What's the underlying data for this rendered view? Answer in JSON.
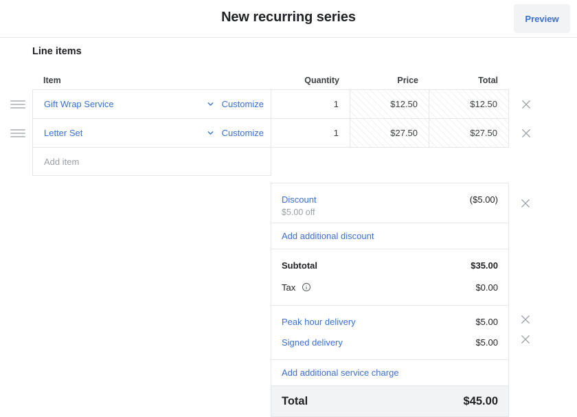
{
  "header": {
    "title": "New recurring series",
    "preview_label": "Preview"
  },
  "line_items": {
    "section_title": "Line items",
    "columns": {
      "item": "Item",
      "quantity": "Quantity",
      "price": "Price",
      "total": "Total"
    },
    "rows": [
      {
        "name": "Gift Wrap Service",
        "customize_label": "Customize",
        "quantity": "1",
        "price": "$12.50",
        "total": "$12.50"
      },
      {
        "name": "Letter Set",
        "customize_label": "Customize",
        "quantity": "1",
        "price": "$27.50",
        "total": "$27.50"
      }
    ],
    "add_item_placeholder": "Add item"
  },
  "summary": {
    "discount": {
      "label": "Discount",
      "value": "($5.00)",
      "subtext": "$5.00 off"
    },
    "add_discount_label": "Add additional discount",
    "subtotal": {
      "label": "Subtotal",
      "value": "$35.00"
    },
    "tax": {
      "label": "Tax",
      "value": "$0.00"
    },
    "service_charges": [
      {
        "label": "Peak hour delivery",
        "value": "$5.00"
      },
      {
        "label": "Signed delivery",
        "value": "$5.00"
      }
    ],
    "add_service_charge_label": "Add additional service charge",
    "grand_total": {
      "label": "Total",
      "value": "$45.00"
    }
  },
  "colors": {
    "link_blue": "#3b6fd4",
    "text_dark": "#202124",
    "muted": "#9aa0a6",
    "border": "#e4e6e8",
    "total_bg": "#f1f3f4"
  }
}
